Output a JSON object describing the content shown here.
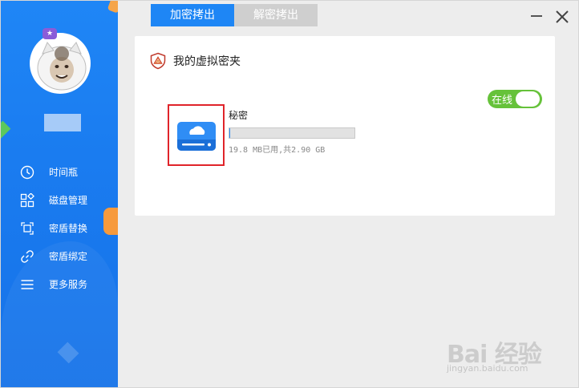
{
  "tabs": [
    {
      "label": "加密拷出",
      "active": true
    },
    {
      "label": "解密拷出",
      "active": false
    }
  ],
  "sidebar": {
    "items": [
      {
        "label": "时间瓶",
        "icon": "clock-icon"
      },
      {
        "label": "磁盘管理",
        "icon": "grid-icon"
      },
      {
        "label": "密盾替换",
        "icon": "swap-icon"
      },
      {
        "label": "密盾绑定",
        "icon": "link-icon"
      },
      {
        "label": "更多服务",
        "icon": "menu-icon"
      }
    ]
  },
  "vault": {
    "title": "我的虚拟密夹",
    "drive": {
      "name": "秘密",
      "usage": "19.8 MB已用,共2.90 GB",
      "used_fraction": 0.0067
    },
    "status_label": "在线",
    "online": true
  },
  "watermark": {
    "brand": "Bai 经验",
    "url": "jingyan.baidu.com"
  },
  "colors": {
    "accent": "#1e86f5",
    "toggle_on": "#66c23a",
    "highlight": "#e0242a"
  }
}
